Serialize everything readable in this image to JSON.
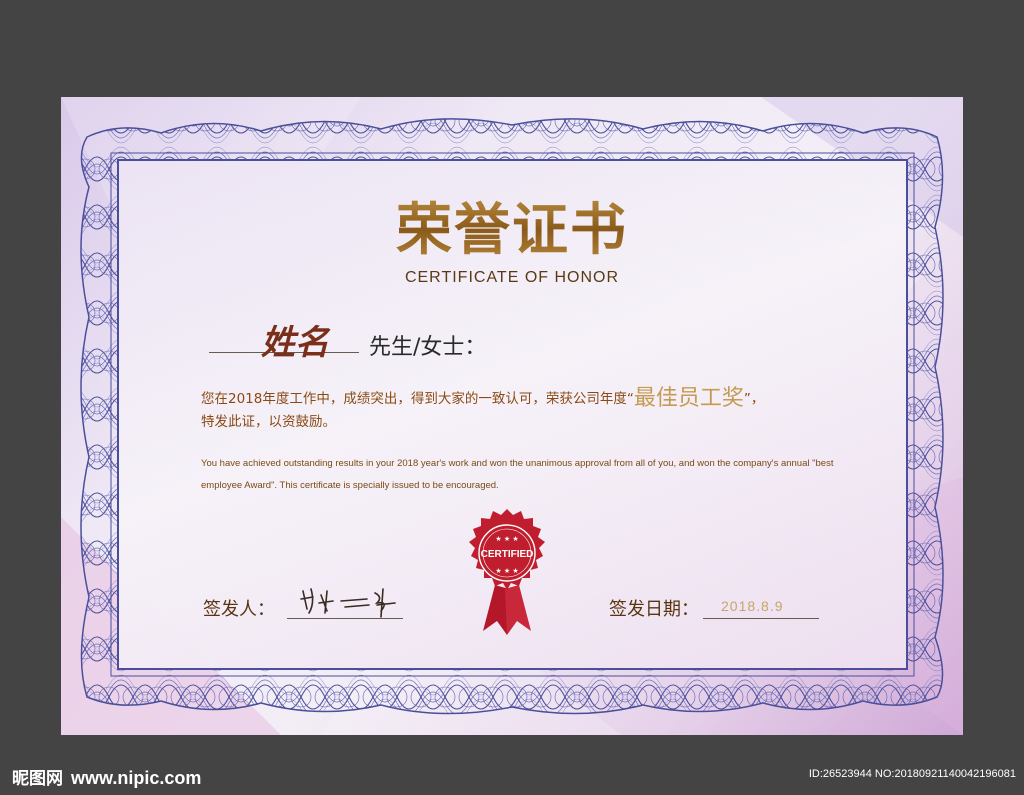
{
  "certificate": {
    "title_cn": "荣誉证书",
    "title_en": "CERTIFICATE OF HONOR",
    "name_handwritten": "姓名",
    "salutation": "先生/女士：",
    "body_cn_main": "您在2018年度工作中，成绩突出，得到大家的一致认可，荣获公司年度“",
    "body_cn_award": "最佳员工奖",
    "body_cn_end": "”，",
    "body_cn_line2": "特发此证，以资鼓励。",
    "body_en": "You have achieved outstanding results in your 2018 year's work and won the unanimous approval from all of you, and won the company's annual \"best employee Award\". This certificate is specially issued to be encouraged.",
    "seal_text": "CERTIFIED",
    "signer_label": "签发人：",
    "date_label": "签发日期：",
    "date_value": "2018.8.9"
  },
  "watermark": {
    "site_name": "昵图网",
    "site_url": "www.nipic.com",
    "image_info": "ID:26523944 NO:20180921140042196081"
  },
  "colors": {
    "frame_blue": "#4b4f9a",
    "gold": "#a8782c",
    "seal_red": "#c01e2e",
    "backdrop": "#444444"
  }
}
